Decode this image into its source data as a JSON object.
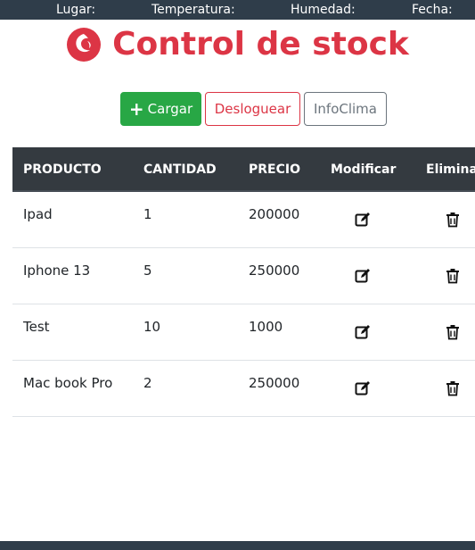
{
  "topbar": {
    "lugar": "Lugar:",
    "temperatura": "Temperatura:",
    "humedad": "Humedad:",
    "fecha": "Fecha:"
  },
  "header": {
    "title": "Control de stock",
    "logo_icon": "fire-swirl-logo",
    "accent_color": "#dc3545"
  },
  "actions": {
    "cargar_label": "Cargar",
    "desloguear_label": "Desloguear",
    "infoclima_label": "InfoClima"
  },
  "table": {
    "headers": [
      "PRODUCTO",
      "CANTIDAD",
      "PRECIO",
      "Modificar",
      "Elimina"
    ],
    "rows": [
      {
        "producto": "Ipad",
        "cantidad": "1",
        "precio": "200000"
      },
      {
        "producto": "Iphone 13",
        "cantidad": "5",
        "precio": "250000"
      },
      {
        "producto": "Test",
        "cantidad": "10",
        "precio": "1000"
      },
      {
        "producto": "Mac book Pro",
        "cantidad": "2",
        "precio": "250000"
      }
    ],
    "edit_icon": "edit-icon",
    "delete_icon": "trash-icon"
  }
}
